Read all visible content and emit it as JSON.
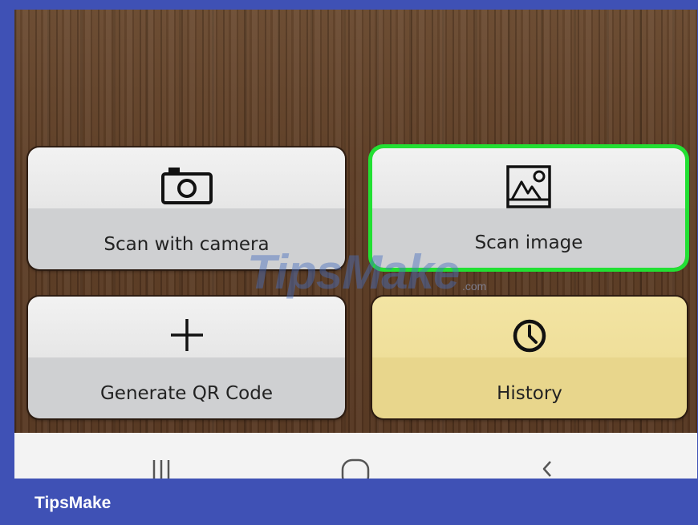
{
  "tiles": {
    "scan_camera": {
      "label": "Scan with camera",
      "icon": "camera-icon"
    },
    "scan_image": {
      "label": "Scan image",
      "icon": "image-icon",
      "highlighted": true,
      "highlight_color": "#22e033"
    },
    "generate_qr": {
      "label": "Generate QR Code",
      "icon": "plus-icon"
    },
    "history": {
      "label": "History",
      "icon": "clock-icon"
    }
  },
  "colors": {
    "tile_gray": "#e6e6e6",
    "tile_yellow": "#efdf9a",
    "frame_blue": "#3f51b5"
  },
  "watermark": {
    "text": "TipsMake",
    "suffix": ".com"
  },
  "brand": {
    "text": "TipsMake"
  },
  "navbar": {
    "recents": "recents-icon",
    "home": "home-icon",
    "back": "back-icon"
  }
}
